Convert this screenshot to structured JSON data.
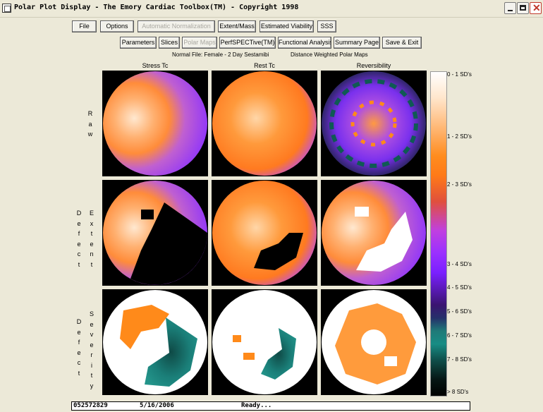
{
  "window": {
    "title": "Polar Plot Display - The Emory Cardiac Toolbox(TM) - Copyright 1998"
  },
  "toolbar1": [
    {
      "label": "File",
      "enabled": true
    },
    {
      "label": "Options",
      "enabled": true
    },
    {
      "label": "Automatic Normalization",
      "enabled": false
    },
    {
      "label": "Extent/Mass",
      "enabled": true
    },
    {
      "label": "Estimated Viability",
      "enabled": true
    },
    {
      "label": "SSS",
      "enabled": true
    }
  ],
  "toolbar2": [
    {
      "label": "Parameters",
      "enabled": true
    },
    {
      "label": "Slices",
      "enabled": true
    },
    {
      "label": "Polar Maps",
      "enabled": false
    },
    {
      "label": "PerfSPECTive(TM)",
      "enabled": true
    },
    {
      "label": "Functional Analysis",
      "enabled": true
    },
    {
      "label": "Summary Page",
      "enabled": true
    },
    {
      "label": "Save & Exit",
      "enabled": true
    }
  ],
  "info": {
    "normal_file": "Normal File:  Female - 2 Day Sestamibi",
    "map_type": "Distance Weighted Polar Maps"
  },
  "columns": [
    "Stress Tc",
    "Rest Tc",
    "Reversibility"
  ],
  "rows": {
    "raw": "Raw",
    "defect_extent_left": "Defect",
    "defect_extent_right": "Extent",
    "defect_severity_left": "Defect",
    "defect_severity_right": "Severity"
  },
  "legend": [
    "0 - 1 SD's",
    "1 - 2 SD's",
    "2 - 3 SD's",
    "3 - 4 SD's",
    "4 - 5 SD's",
    "5 - 6 SD's",
    "6 - 7 SD's",
    "7 - 8 SD's",
    "> 8 SD's"
  ],
  "status": {
    "patient_id": "052572829",
    "date": "5/16/2006",
    "message": "Ready..."
  },
  "colors": {
    "background": "#ece9d8",
    "orange": "#ff8a1a",
    "purple": "#9a30ff",
    "teal": "#1f8a80",
    "white": "#ffffff",
    "black": "#000000"
  }
}
